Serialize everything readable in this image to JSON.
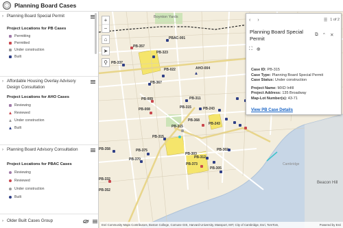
{
  "app": {
    "title": "Planning Board Cases"
  },
  "sidebar": {
    "groups": [
      {
        "title": "Planning Board Special Permit",
        "legend_title": "Project Locations for PB Cases",
        "items": [
          {
            "label": "Permitting",
            "color": "#a07aa8"
          },
          {
            "label": "Permitted",
            "color": "#c9474e"
          },
          {
            "label": "Under construction",
            "color": "#9b9b9b"
          },
          {
            "label": "Built",
            "color": "#2f3f86"
          }
        ]
      },
      {
        "title": "Affordable Housing Overlay Advisory Design Consultation",
        "legend_title": "Project Locations for AHO Cases",
        "items": [
          {
            "label": "Reviewing",
            "color": "#a07aa8"
          },
          {
            "label": "Reviewed",
            "color": "#c9474e"
          },
          {
            "label": "Under construction",
            "color": "#9b9b9b"
          },
          {
            "label": "Built",
            "color": "#2f3f86"
          }
        ]
      },
      {
        "title": "Planning Board Advisory Consultation",
        "legend_title": "Project Locations for PBAC Cases",
        "items": [
          {
            "label": "Reviewing",
            "color": "#a07aa8"
          },
          {
            "label": "Reviewed",
            "color": "#c9474e"
          },
          {
            "label": "Under construction",
            "color": "#9b9b9b"
          },
          {
            "label": "Built",
            "color": "#2f3f86"
          }
        ]
      }
    ],
    "bottom_group": "Older Built Cases Group"
  },
  "map": {
    "places": [
      "Boynton Yards",
      "Cambridge",
      "Beacon Hill"
    ],
    "labels": [
      "PBAC-001",
      "PB-357",
      "PB-323",
      "PB-337",
      "PB-022",
      "AHO-004",
      "PB-367",
      "PB-009",
      "PB-008",
      "PB-311",
      "PB-315",
      "PB-243",
      "PB-368",
      "PB-315",
      "PB-243",
      "PB-315",
      "PB-358",
      "PB-375",
      "PB-370",
      "PB-303",
      "PB-312",
      "PB-373",
      "PB-302",
      "PB-305",
      "PB-332",
      "PB-352"
    ],
    "attribution": "Esri Community Maps Contributors, Boston College, Comune GIS, Harvard University, Massport, MIT, City of Cambridge, Esri, TomTom,",
    "powered_by": "Powered by Esri",
    "controls": {
      "zoom_in": "+",
      "zoom_out": "−"
    }
  },
  "popup": {
    "pager": "1 of 2",
    "title": "Planning Board Special Permit",
    "fields": [
      {
        "label": "Case ID:",
        "value": "PB-315"
      },
      {
        "label": "Case Type:",
        "value": "Planning Board Special Permit"
      },
      {
        "label": "Case Status:",
        "value": "Under construction"
      },
      {
        "label": "Project Name:",
        "value": "MXD Infill"
      },
      {
        "label": "Project Address:",
        "value": "135 Broadway"
      },
      {
        "label": "Map-Lot Number(s):",
        "value": "43-71"
      }
    ],
    "link": "View PB Case Details"
  }
}
